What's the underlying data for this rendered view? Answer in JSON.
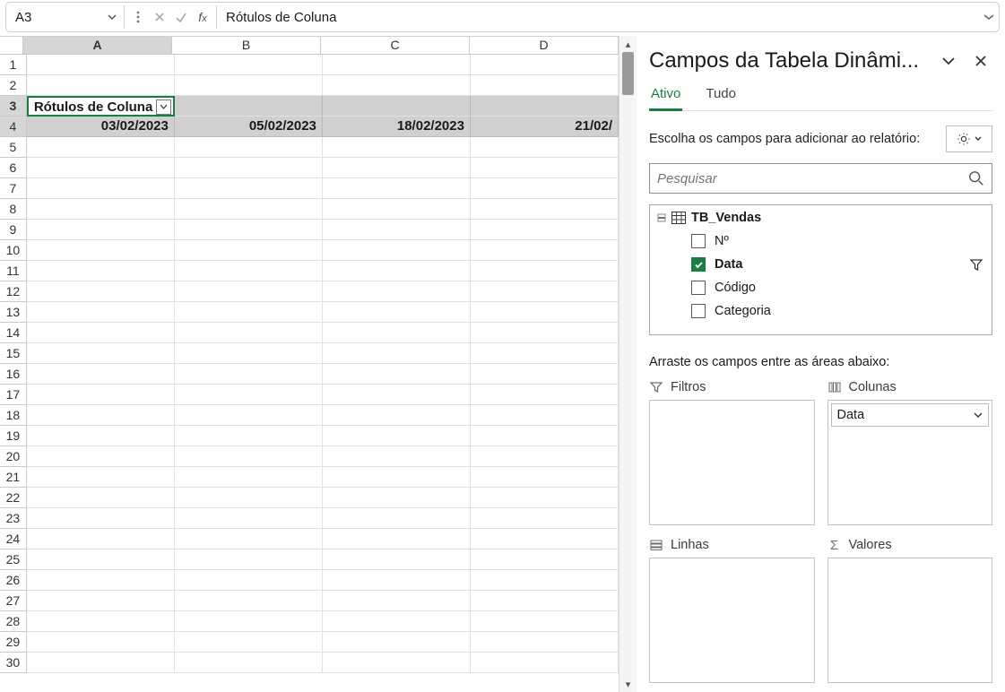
{
  "formula_bar": {
    "namebox": "A3",
    "content": "Rótulos de Coluna"
  },
  "sheet": {
    "columns": [
      "A",
      "B",
      "C",
      "D"
    ],
    "rows": [
      "1",
      "2",
      "3",
      "4",
      "5",
      "6",
      "7",
      "8",
      "9",
      "10",
      "11",
      "12",
      "13",
      "14",
      "15",
      "16",
      "17",
      "18",
      "19",
      "20",
      "21",
      "22",
      "23",
      "24",
      "25",
      "26",
      "27",
      "28",
      "29",
      "30"
    ],
    "active_col": 0,
    "active_row": 2,
    "pivot_label": "Rótulos de Coluna",
    "dates": [
      "03/02/2023",
      "05/02/2023",
      "18/02/2023",
      "21/02/"
    ]
  },
  "panel": {
    "title": "Campos da Tabela Dinâmi...",
    "tabs": {
      "active": "Ativo",
      "all": "Tudo"
    },
    "instruction": "Escolha os campos para adicionar ao relatório:",
    "search_placeholder": "Pesquisar",
    "table_name": "TB_Vendas",
    "fields": [
      {
        "name": "Nº",
        "checked": false
      },
      {
        "name": "Data",
        "checked": true,
        "filter": true
      },
      {
        "name": "Código",
        "checked": false
      },
      {
        "name": "Categoria",
        "checked": false
      }
    ],
    "areas_label": "Arraste os campos entre as áreas abaixo:",
    "areas": {
      "filters_h": "Filtros",
      "columns_h": "Colunas",
      "rows_h": "Linhas",
      "values_h": "Valores",
      "columns_chip": "Data"
    }
  }
}
